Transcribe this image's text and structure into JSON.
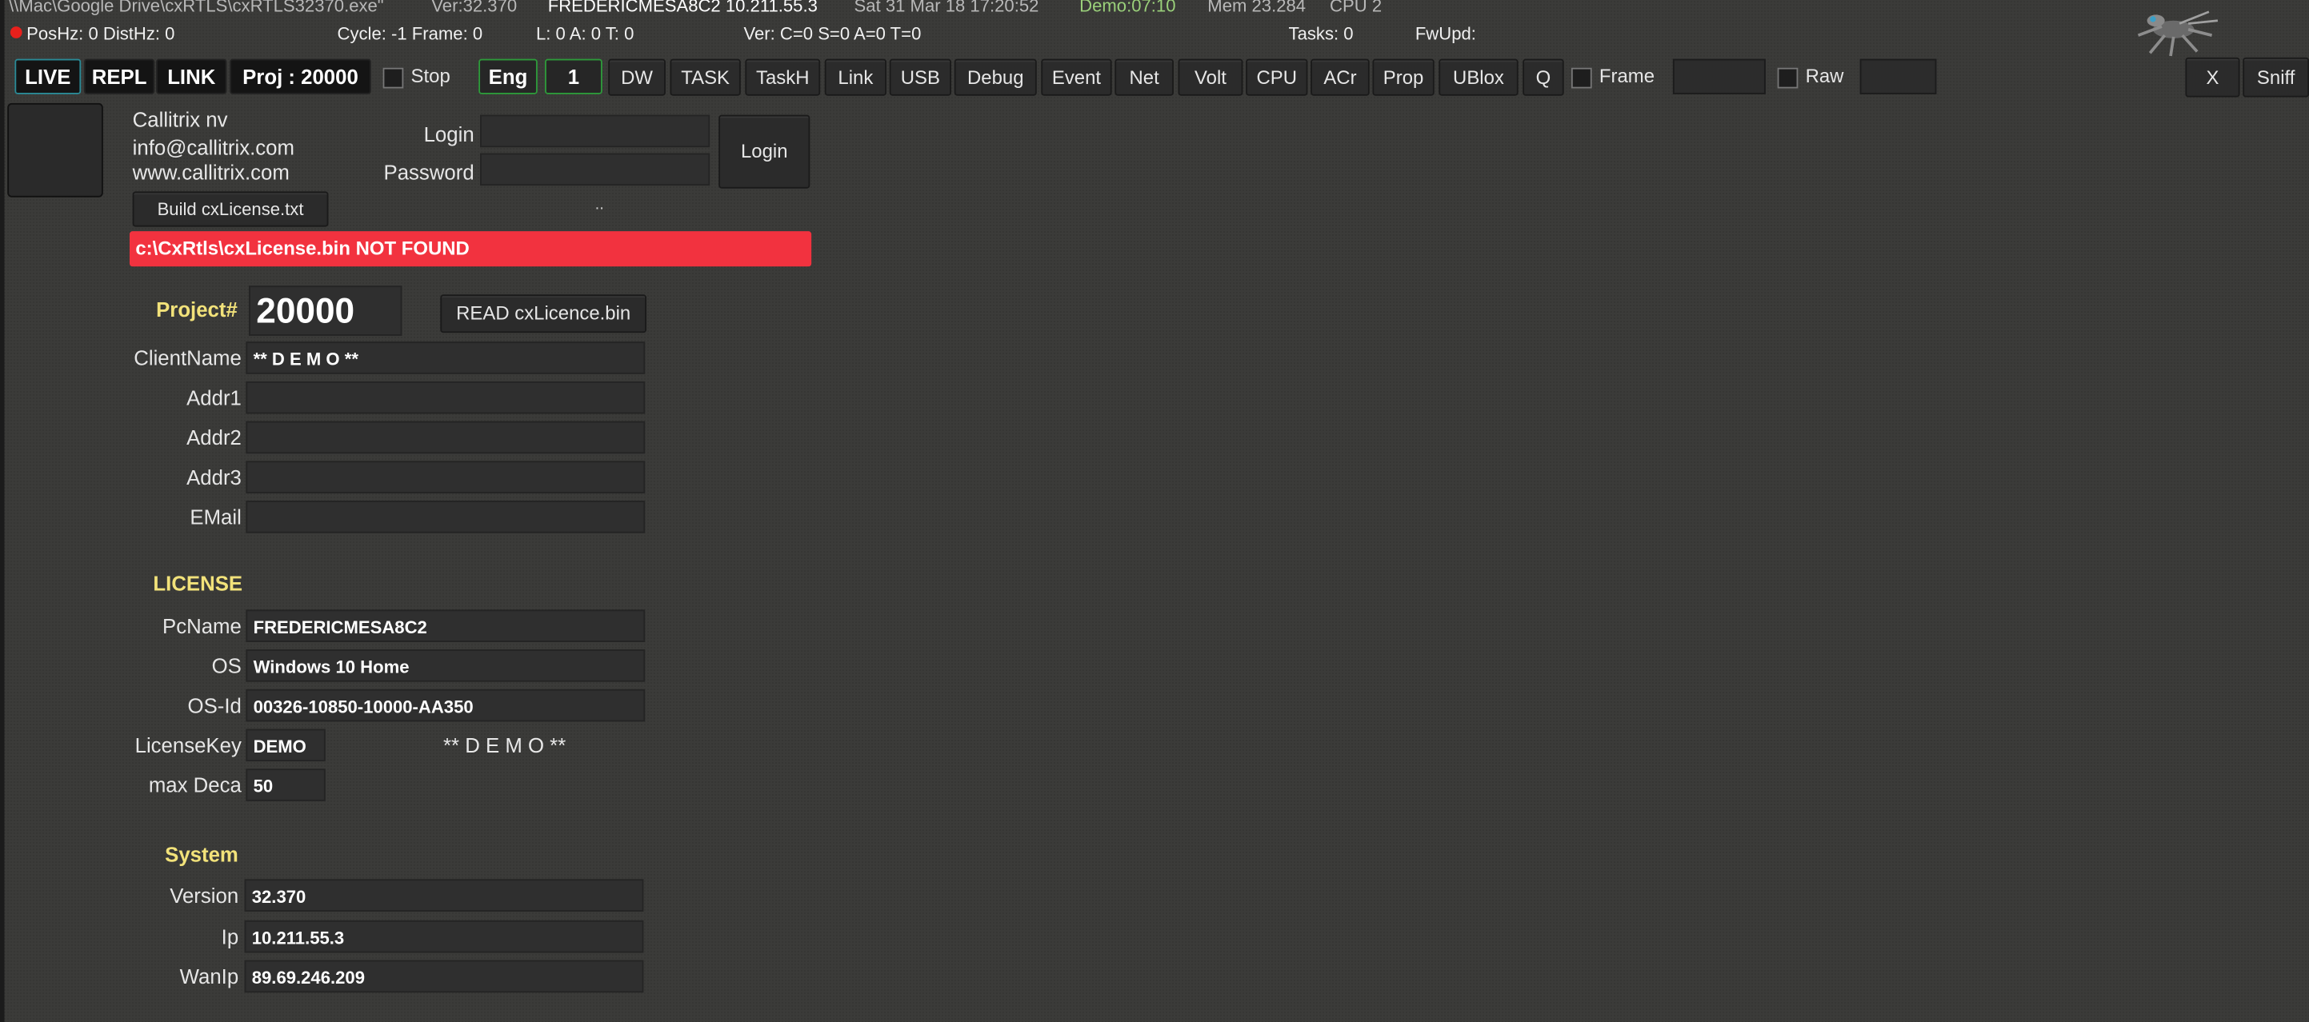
{
  "titlebar": {
    "path": "\\\\Mac\\Google Drive\\cxRTLS\\cxRTLS32370.exe\"",
    "ver": "Ver:32.370",
    "host": "FREDERICMESA8C2 10.211.55.3",
    "date": "Sat 31 Mar 18 17:20:52",
    "demo": "Demo:07:10",
    "mem": "Mem 23.284",
    "cpu": "CPU 2"
  },
  "status": {
    "poshz": "PosHz: 0 DistHz: 0",
    "cycle": "Cycle: -1  Frame: 0",
    "lat": "L: 0  A: 0  T: 0",
    "ver": "Ver: C=0 S=0 A=0 T=0",
    "tasks": "Tasks: 0",
    "fwupd": "FwUpd:"
  },
  "toolbar": {
    "live": "LIVE",
    "repl": "REPL",
    "link": "LINK",
    "proj": "Proj : 20000",
    "stop": "Stop",
    "eng": "Eng",
    "num": "1",
    "buttons": [
      "DW",
      "TASK",
      "TaskH",
      "Link",
      "USB",
      "Debug",
      "Event",
      "Net",
      "Volt",
      "CPU",
      "ACr",
      "Prop",
      "UBlox",
      "Q"
    ],
    "frame": "Frame",
    "raw": "Raw",
    "x": "X",
    "sniff": "Sniff"
  },
  "company": {
    "name": "Callitrix nv",
    "email": "info@callitrix.com",
    "web": "www.callitrix.com",
    "build_btn": "Build cxLicense.txt",
    "dots": ".."
  },
  "login": {
    "login_label": "Login",
    "password_label": "Password",
    "login_btn": "Login",
    "login_value": "",
    "password_value": ""
  },
  "error": {
    "message": "c:\\CxRtls\\cxLicense.bin NOT FOUND",
    "color": "#f2323f"
  },
  "project": {
    "label": "Project#",
    "value": "20000",
    "read_btn": "READ cxLicence.bin"
  },
  "client": {
    "fields": [
      {
        "label": "ClientName",
        "value": "** D E M O **"
      },
      {
        "label": "Addr1",
        "value": ""
      },
      {
        "label": "Addr2",
        "value": ""
      },
      {
        "label": "Addr3",
        "value": ""
      },
      {
        "label": "EMail",
        "value": ""
      }
    ]
  },
  "license": {
    "heading": "LICENSE",
    "pcname_label": "PcName",
    "pcname": "FREDERICMESA8C2",
    "os_label": "OS",
    "os": "Windows 10 Home",
    "osid_label": "OS-Id",
    "osid": "00326-10850-10000-AA350",
    "key_label": "LicenseKey",
    "key": "DEMO",
    "key_note": "** D E M O **",
    "maxdeca_label": "max Deca",
    "maxdeca": "50"
  },
  "system": {
    "heading": "System",
    "version_label": "Version",
    "version": "32.370",
    "ip_label": "Ip",
    "ip": "10.211.55.3",
    "wanip_label": "WanIp",
    "wanip": "89.69.246.209"
  },
  "colors": {
    "background": "#3b3b39",
    "heading": "#f2e27a",
    "demo_timer": "#9ad07a",
    "live_border": "#2a8a96",
    "eng_border": "#2d9a3a"
  },
  "icons": {
    "logo": "robot-bug-logo",
    "status": "red-dot-icon"
  }
}
